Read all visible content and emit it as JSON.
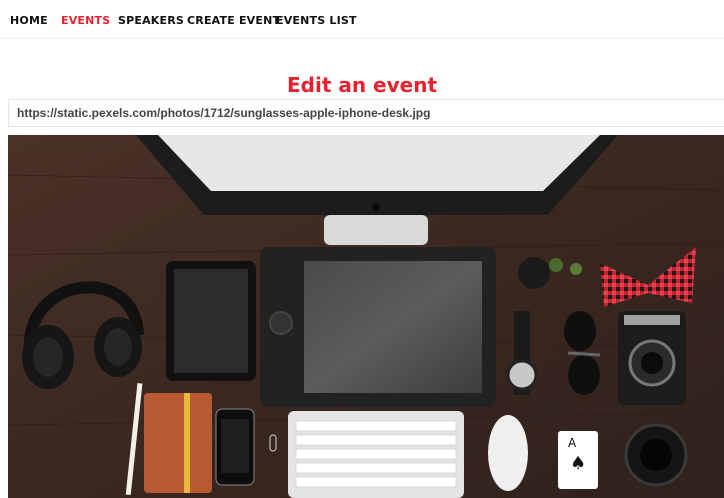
{
  "nav": {
    "items": [
      {
        "label": "HOME",
        "active": false
      },
      {
        "label": "EVENTS",
        "active": true
      },
      {
        "label": "SPEAKERS",
        "active": false
      },
      {
        "label": "CREATE EVENT",
        "active": false
      },
      {
        "label": "EVENTS LIST",
        "active": false
      }
    ]
  },
  "page": {
    "title": "Edit an event"
  },
  "form": {
    "image_url": "https://static.pexels.com/photos/1712/sunglasses-apple-iphone-desk.jpg"
  },
  "colors": {
    "accent": "#e8212f",
    "desk": "#3f2c22"
  }
}
